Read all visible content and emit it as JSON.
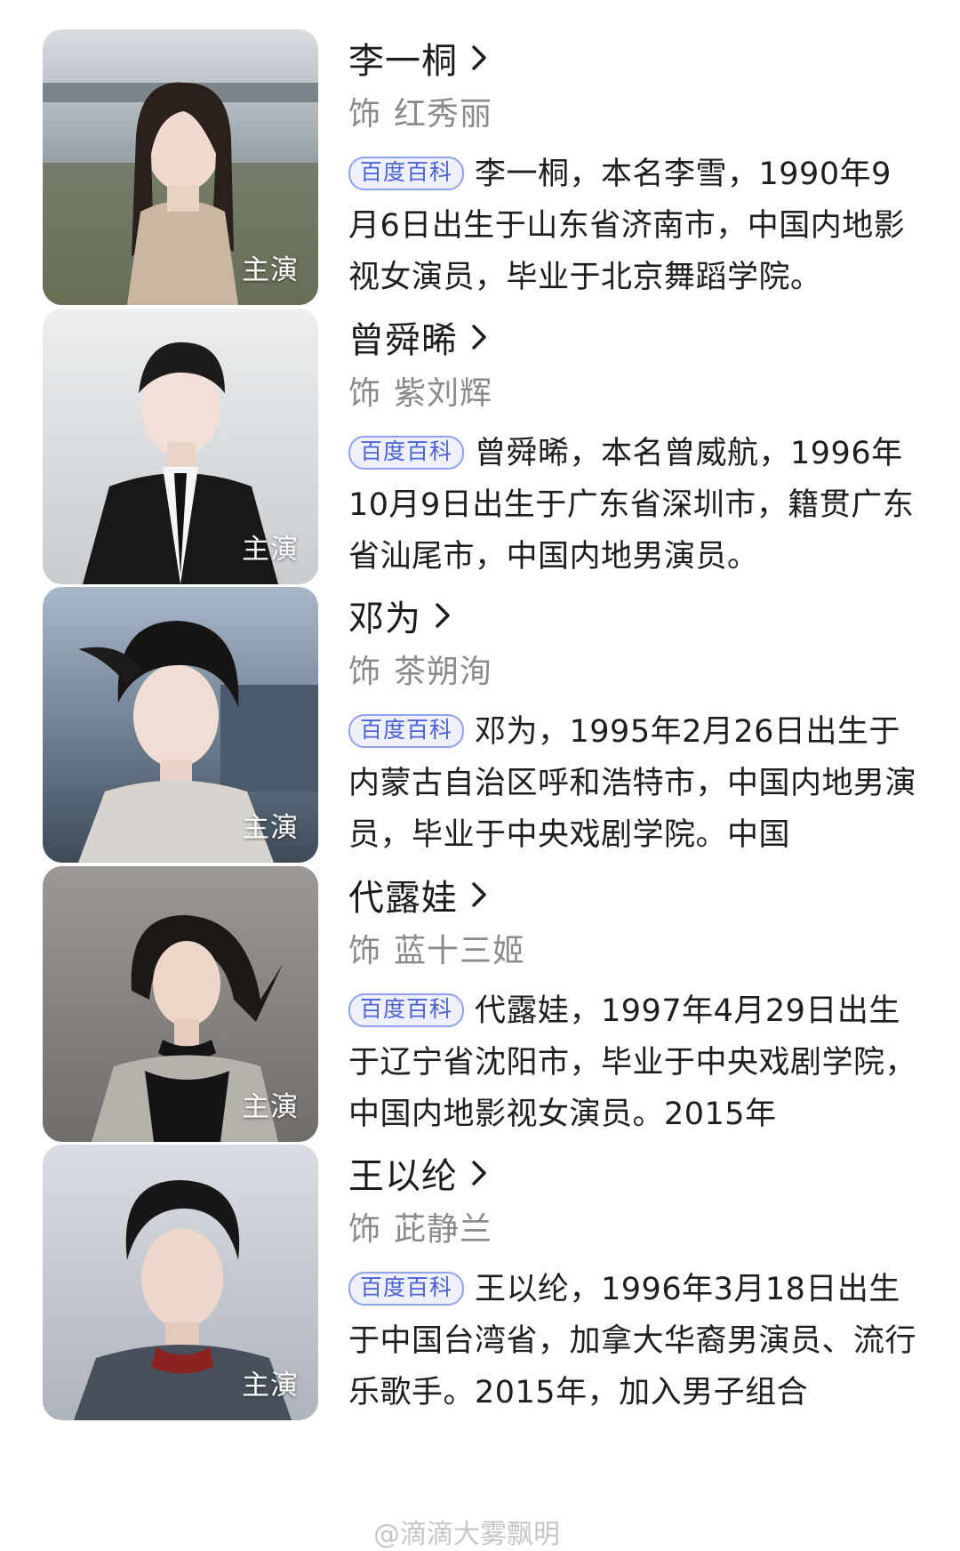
{
  "cast": [
    {
      "name": "李一桐",
      "role_prefix": "饰",
      "role": "红秀丽",
      "badge": "百度百科",
      "bio": "李一桐，本名李雪，1990年9月6日出生于山东省济南市，中国内地影视女演员，毕业于北京舞蹈学院。",
      "tag": "主演"
    },
    {
      "name": "曾舜晞",
      "role_prefix": "饰",
      "role": "紫刘辉",
      "badge": "百度百科",
      "bio": "曾舜晞，本名曾威航，1996年10月9日出生于广东省深圳市，籍贯广东省汕尾市，中国内地男演员。",
      "tag": "主演"
    },
    {
      "name": "邓为",
      "role_prefix": "饰",
      "role": "茶朔洵",
      "badge": "百度百科",
      "bio": "邓为，1995年2月26日出生于内蒙古自治区呼和浩特市，中国内地男演员，毕业于中央戏剧学院。中国",
      "tag": "主演"
    },
    {
      "name": "代露娃",
      "role_prefix": "饰",
      "role": "蓝十三姬",
      "badge": "百度百科",
      "bio": "代露娃，1997年4月29日出生于辽宁省沈阳市，毕业于中央戏剧学院，中国内地影视女演员。2015年",
      "tag": "主演"
    },
    {
      "name": "王以纶",
      "role_prefix": "饰",
      "role": "茈静兰",
      "badge": "百度百科",
      "bio": "王以纶，1996年3月18日出生于中国台湾省，加拿大华裔男演员、流行乐歌手。2015年，加入男子组合",
      "tag": "主演"
    }
  ],
  "watermark": "@滴滴大雾飘明"
}
